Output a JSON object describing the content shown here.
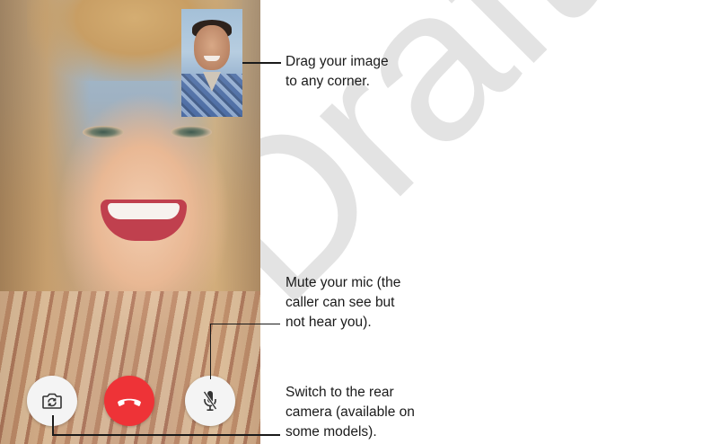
{
  "watermark": "Draft",
  "video": {
    "remote_view": "caller-video",
    "self_view": "self-preview"
  },
  "controls": {
    "flip_camera": {
      "icon": "camera-flip-icon"
    },
    "end_call": {
      "icon": "phone-hangup-icon",
      "color": "#ee3337"
    },
    "mute": {
      "icon": "mic-mute-icon"
    }
  },
  "callouts": {
    "drag": "Drag your image\nto any corner.",
    "mute": "Mute your mic (the\ncaller can see but\nnot hear you).",
    "switch": "Switch to the rear\ncamera (available on\nsome models)."
  }
}
